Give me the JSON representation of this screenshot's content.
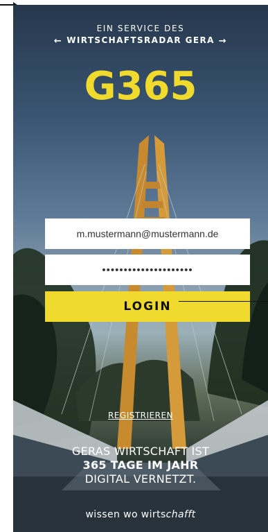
{
  "header": {
    "service_label": "EIN SERVICE DES",
    "company_label": "WIRTSCHAFTSRADAR GERA",
    "left_arrow": "←",
    "right_arrow": "→"
  },
  "logo": {
    "text": "G365"
  },
  "login_form": {
    "email_value": "m.mustermann@mustermann.de",
    "password_mask": "•••••••••••••••••••••",
    "login_label": "LOGIN"
  },
  "register_link": "REGISTRIEREN",
  "tagline": {
    "line1": "GERAS WIRTSCHAFT IST",
    "line2": "365 TAGE IM JAHR",
    "line3": "DIGITAL VERNETZT."
  },
  "slogan": {
    "prefix": "wissen wo wirts",
    "suffix": "chafft"
  },
  "colors": {
    "accent_yellow": "#f0da2d",
    "text_white": "#ffffff"
  }
}
